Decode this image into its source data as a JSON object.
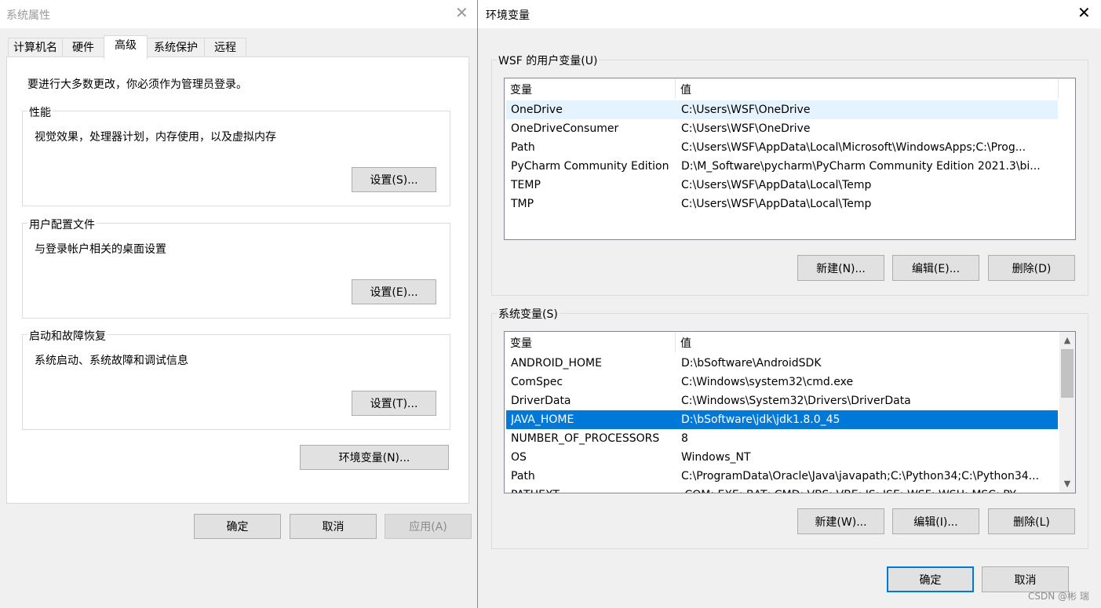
{
  "system_properties": {
    "title": "系统属性",
    "tabs": [
      {
        "label": "计算机名"
      },
      {
        "label": "硬件"
      },
      {
        "label": "高级"
      },
      {
        "label": "系统保护"
      },
      {
        "label": "远程"
      }
    ],
    "admin_notice": "要进行大多数更改，你必须作为管理员登录。",
    "groups": [
      {
        "title": "性能",
        "description": "视觉效果，处理器计划，内存使用，以及虚拟内存",
        "button": "设置(S)..."
      },
      {
        "title": "用户配置文件",
        "description": "与登录帐户相关的桌面设置",
        "button": "设置(E)..."
      },
      {
        "title": "启动和故障恢复",
        "description": "系统启动、系统故障和调试信息",
        "button": "设置(T)..."
      }
    ],
    "env_button": "环境变量(N)...",
    "ok": "确定",
    "cancel": "取消",
    "apply": "应用(A)"
  },
  "env_vars": {
    "title": "环境变量",
    "user_group_title": "WSF 的用户变量(U)",
    "columns": {
      "var": "变量",
      "val": "值"
    },
    "user_vars": [
      {
        "name": "OneDrive",
        "value": "C:\\Users\\WSF\\OneDrive"
      },
      {
        "name": "OneDriveConsumer",
        "value": "C:\\Users\\WSF\\OneDrive"
      },
      {
        "name": "Path",
        "value": "C:\\Users\\WSF\\AppData\\Local\\Microsoft\\WindowsApps;C:\\Prog..."
      },
      {
        "name": "PyCharm Community Edition",
        "value": "D:\\M_Software\\pycharm\\PyCharm Community Edition 2021.3\\bi..."
      },
      {
        "name": "TEMP",
        "value": "C:\\Users\\WSF\\AppData\\Local\\Temp"
      },
      {
        "name": "TMP",
        "value": "C:\\Users\\WSF\\AppData\\Local\\Temp"
      }
    ],
    "user_buttons": {
      "new": "新建(N)...",
      "edit": "编辑(E)...",
      "delete": "删除(D)"
    },
    "system_group_title": "系统变量(S)",
    "system_vars": [
      {
        "name": "ANDROID_HOME",
        "value": "D:\\bSoftware\\AndroidSDK"
      },
      {
        "name": "ComSpec",
        "value": "C:\\Windows\\system32\\cmd.exe"
      },
      {
        "name": "DriverData",
        "value": "C:\\Windows\\System32\\Drivers\\DriverData"
      },
      {
        "name": "JAVA_HOME",
        "value": "D:\\bSoftware\\jdk\\jdk1.8.0_45"
      },
      {
        "name": "NUMBER_OF_PROCESSORS",
        "value": "8"
      },
      {
        "name": "OS",
        "value": "Windows_NT"
      },
      {
        "name": "Path",
        "value": "C:\\ProgramData\\Oracle\\Java\\javapath;C:\\Python34;C:\\Python34..."
      },
      {
        "name": "PATHEXT",
        "value": ".COM;.EXE;.BAT;.CMD;.VBS;.VBE;.JS;.JSE;.WSF;.WSH;.MSC;.PY"
      }
    ],
    "selected_system_var": "JAVA_HOME",
    "system_buttons": {
      "new": "新建(W)...",
      "edit": "编辑(I)...",
      "delete": "删除(L)"
    },
    "ok": "确定",
    "cancel": "取消"
  },
  "watermark": "CSDN @彬 瑞",
  "colors": {
    "selection": "#0078d7",
    "hover": "#e5f3ff",
    "default_border": "#0078d7"
  }
}
